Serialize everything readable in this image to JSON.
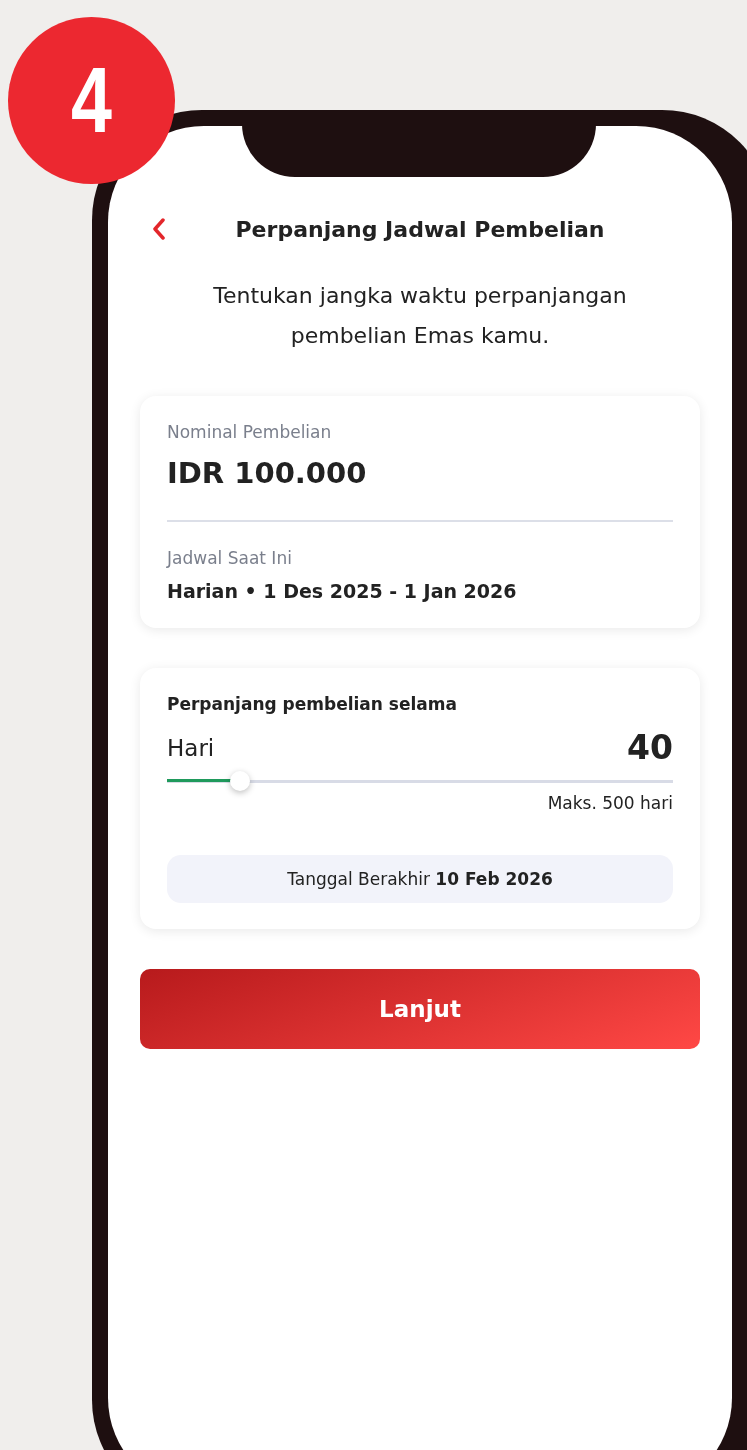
{
  "step_badge": "4",
  "header": {
    "title": "Perpanjang Jadwal Pembelian"
  },
  "subtitle": "Tentukan jangka waktu perpanjangan pembelian Emas kamu.",
  "summary_card": {
    "nominal_label": "Nominal Pembelian",
    "nominal_value": "IDR 100.000",
    "schedule_label": "Jadwal Saat Ini",
    "schedule_value": "Harian • 1 Des 2025 - 1 Jan 2026"
  },
  "extension_card": {
    "title": "Perpanjang pembelian selama",
    "unit_label": "Hari",
    "value": "40",
    "slider": {
      "level": 0.145
    },
    "max_label": "Maks. 500 hari",
    "end_date": "Tanggal Berakhir **10 Feb 2026**"
  },
  "button": "Lanjut"
}
